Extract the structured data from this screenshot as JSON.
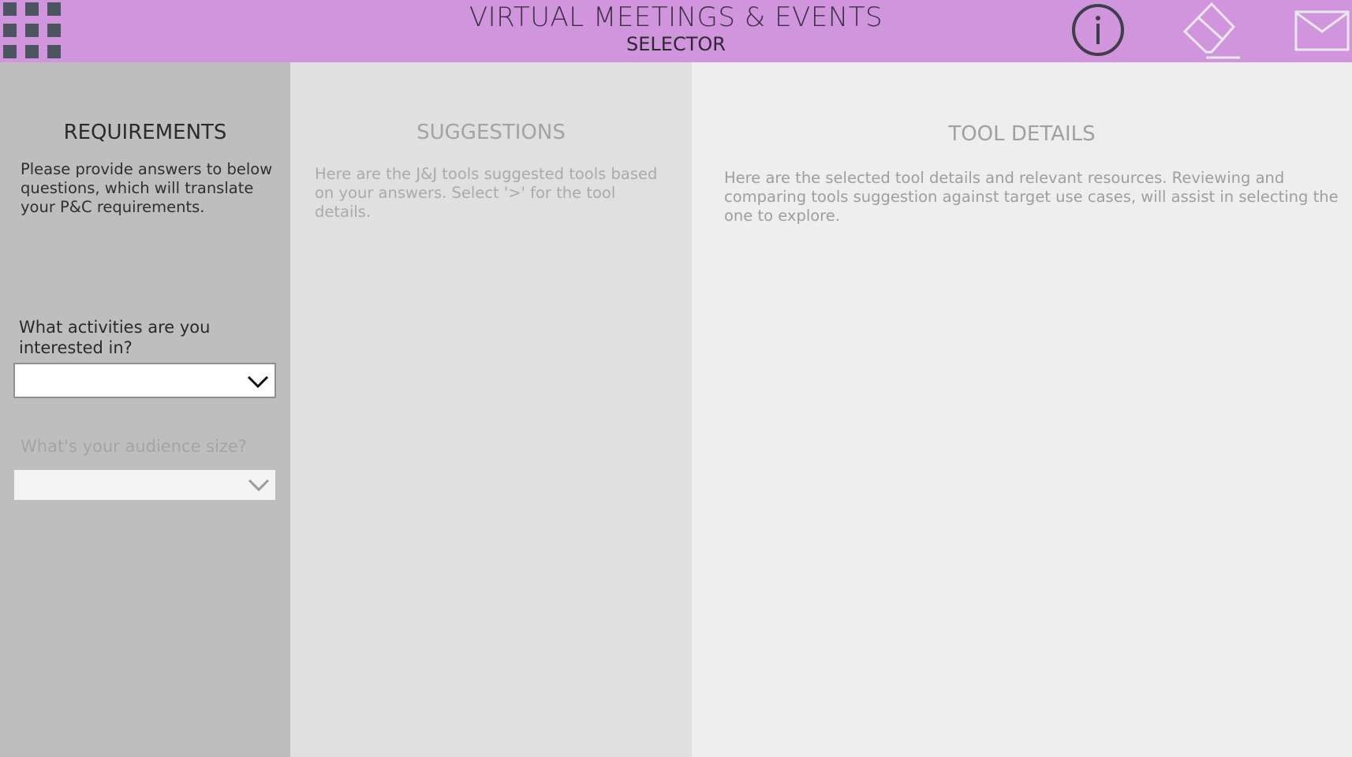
{
  "header": {
    "title": "VIRTUAL MEETINGS & EVENTS",
    "subtitle": "SELECTOR",
    "background": "#d095dc",
    "menu_icon": "grid-menu-icon",
    "info_icon": "info-icon",
    "eraser_icon": "eraser-icon",
    "mail_icon": "mail-icon"
  },
  "requirements": {
    "title": "REQUIREMENTS",
    "description": "Please provide answers to below questions, which will translate your P&C requirements.",
    "questions": [
      {
        "label": "What activities are you interested in?",
        "value": "",
        "enabled": true
      },
      {
        "label": "What's your audience size?",
        "value": "",
        "enabled": false
      }
    ]
  },
  "suggestions": {
    "title": "SUGGESTIONS",
    "description": "Here are the J&J tools suggested tools based on your answers. Select '>' for the tool details."
  },
  "tool_details": {
    "title": "TOOL DETAILS",
    "description": "Here are the selected tool details and relevant resources. Reviewing and comparing tools suggestion against target use cases, will assist in selecting the one to explore."
  }
}
